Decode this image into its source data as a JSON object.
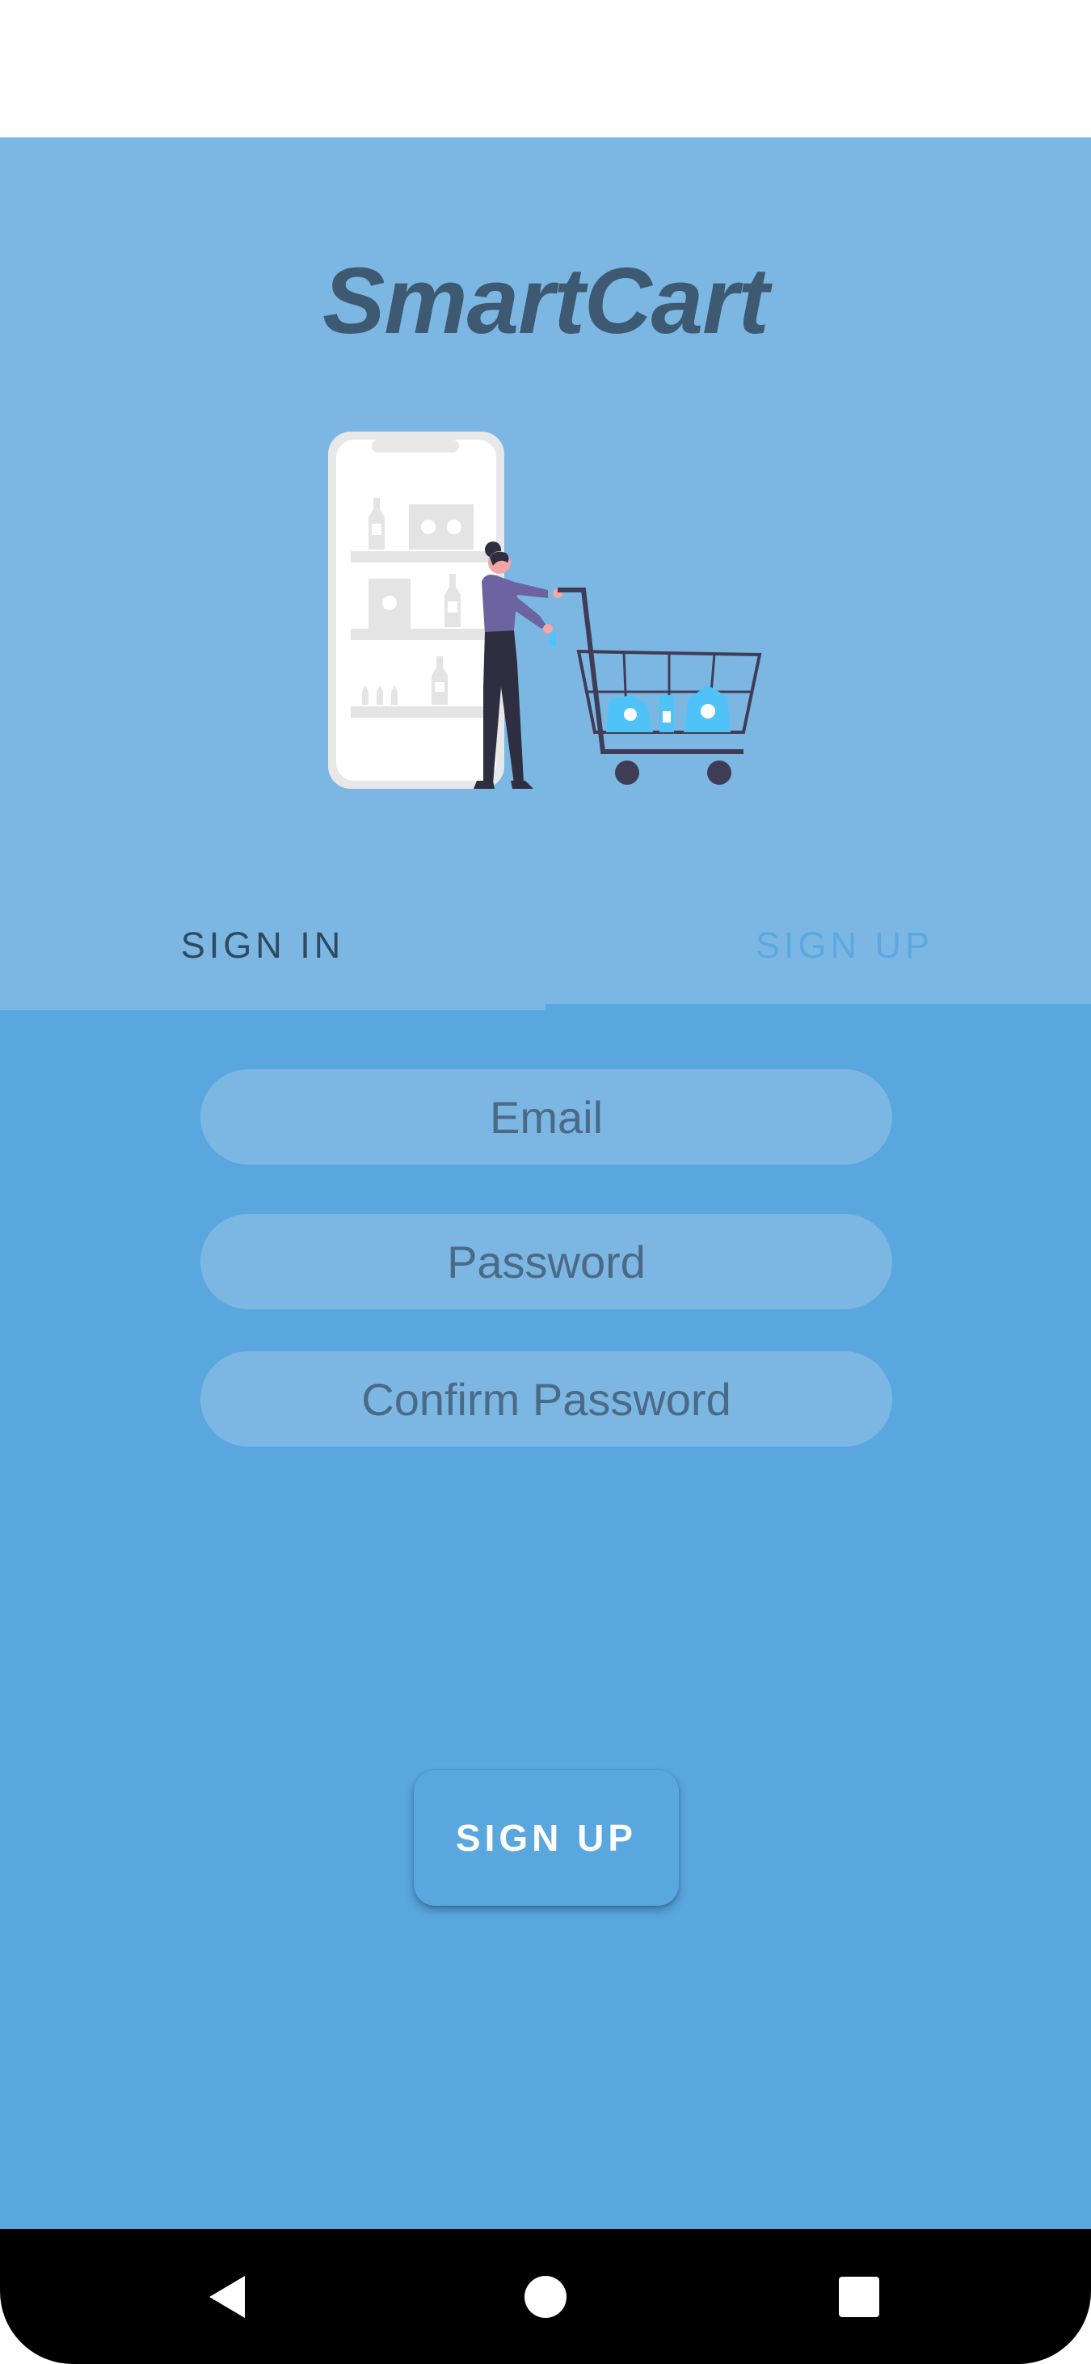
{
  "app": {
    "title": "SmartCart"
  },
  "tabs": [
    {
      "label": "SIGN IN",
      "active": true
    },
    {
      "label": "SIGN UP",
      "active": false
    }
  ],
  "form": {
    "email_placeholder": "Email",
    "password_placeholder": "Password",
    "confirm_placeholder": "Confirm Password",
    "submit_label": "SIGN UP"
  },
  "navigation": {
    "icons": [
      "back-icon",
      "home-icon",
      "recents-icon"
    ]
  },
  "colors": {
    "header_bg": "#7cb7e4",
    "content_bg": "#5aa6de",
    "title": "#3e5a72",
    "nav_bar": "#000000"
  }
}
